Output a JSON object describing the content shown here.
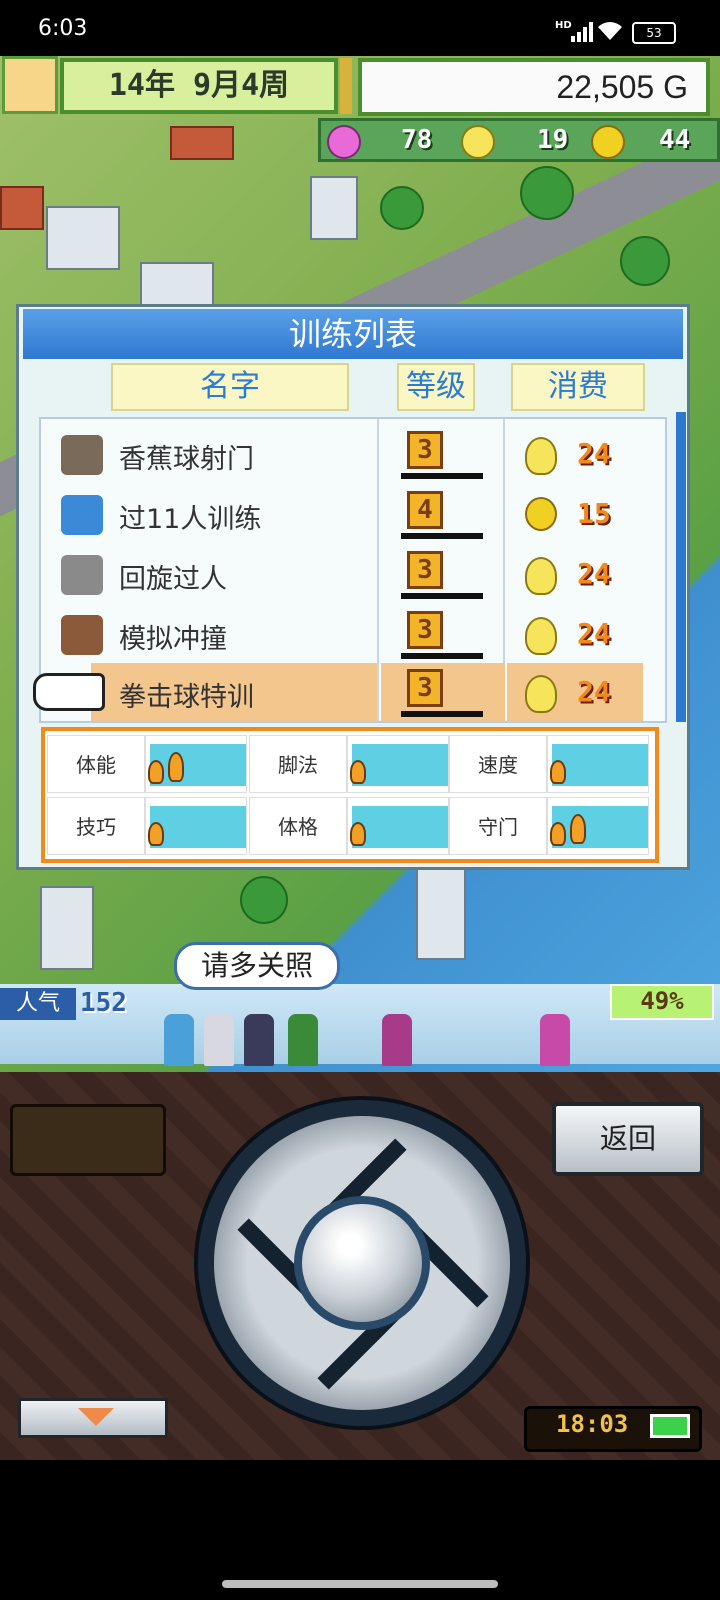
{
  "status_bar": {
    "time": "6:03",
    "network_label": "HD",
    "battery": "53"
  },
  "hud": {
    "date": "14年 9月4周",
    "money": "22,505 G",
    "stats": [
      {
        "icon": "heart-icon",
        "value": "78",
        "color": "#e86ad8"
      },
      {
        "icon": "lightbulb-icon",
        "value": "19",
        "color": "#f6e45a"
      },
      {
        "icon": "coin-icon",
        "value": "44",
        "color": "#f0d020"
      }
    ]
  },
  "dialog": {
    "title": "训练列表",
    "headers": {
      "name": "名字",
      "level": "等级",
      "cost": "消费"
    },
    "items": [
      {
        "name": "香蕉球射门",
        "level": "3",
        "cost_icon": "lightbulb-icon",
        "cost": "24"
      },
      {
        "name": "过11人训练",
        "level": "4",
        "cost_icon": "coin-icon",
        "cost": "15"
      },
      {
        "name": "回旋过人",
        "level": "3",
        "cost_icon": "lightbulb-icon",
        "cost": "24"
      },
      {
        "name": "模拟冲撞",
        "level": "3",
        "cost_icon": "lightbulb-icon",
        "cost": "24"
      },
      {
        "name": "拳击球特训",
        "level": "3",
        "cost_icon": "lightbulb-icon",
        "cost": "24",
        "selected": true
      }
    ],
    "attributes": [
      {
        "label": "体能",
        "flames": 2
      },
      {
        "label": "脚法",
        "flames": 1
      },
      {
        "label": "速度",
        "flames": 1
      },
      {
        "label": "技巧",
        "flames": 1
      },
      {
        "label": "体格",
        "flames": 1
      },
      {
        "label": "守门",
        "flames": 2
      }
    ]
  },
  "scene": {
    "speech": "请多关照",
    "popularity_label": "人气",
    "popularity_value": "152",
    "percent": "49%"
  },
  "controller": {
    "back_label": "返回",
    "clock": "18:03"
  }
}
